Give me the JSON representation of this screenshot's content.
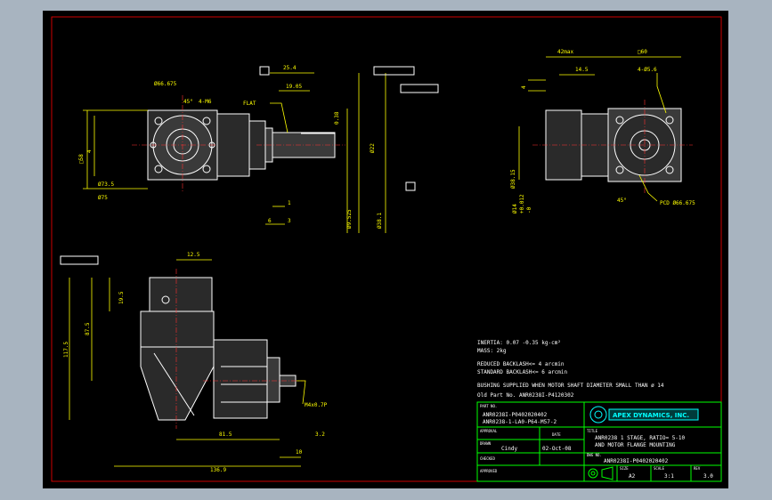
{
  "drawing": {
    "dims_top_left": {
      "d1": "25.4",
      "d2": "19.05",
      "flat": "FLAT",
      "d3": "0.38",
      "d4": "Ø66.675",
      "angle": "45°",
      "d5": "4-M6",
      "d6": "Ø73.5",
      "d7": "Ø75",
      "d8": "□58",
      "d9": "6",
      "d10": "1",
      "d11": "Ø9.525",
      "d12": "Ø38.1",
      "d13": "Ø22",
      "d14": "3",
      "d15": "4"
    },
    "datums": {
      "a_label": "A",
      "b_label": "B",
      "tol1": "0.03",
      "tol1_ref": "A-B",
      "tol2": "0.02",
      "tol2_ref": "A",
      "tol3": "0.05",
      "tol3_ref": "A"
    },
    "dims_top_right": {
      "d1": "42max",
      "d2": "14.5",
      "d3": "□60",
      "d4": "4-Ø5.6",
      "d5": "PCD Ø66.675",
      "d6": "Ø38.15",
      "angle": "45°",
      "d7": "4",
      "d8": "Ø14",
      "d9": "+0.012",
      "d10": "-0"
    },
    "dims_bottom": {
      "d1": "12.5",
      "d2": "19.5",
      "d3": "87.5",
      "d4": "117.5",
      "d5": "81.5",
      "d6": "136.9",
      "d7": "3.2",
      "d8": "10",
      "d9": "M4x0.7P"
    },
    "specs": [
      "INERTIA: 0.07 -0.35 kg-cm²",
      "MASS: 2kg",
      "REDUCED BACKLASH<= 4 arcmin",
      "STANDARD BACKLASH<= 6 arcmin",
      "BUSHING SUPPLIED WHEN MOTOR SHAFT DIAMETER SMALL THAN ø 14",
      "Old Part No. ANR0238I-P4120302"
    ]
  },
  "title_block": {
    "part_no_label": "PART NO.",
    "part_no_1": "ANR0238I-P0402020402",
    "part_no_2": "ANR0238-1-LA0-P64-M57-2",
    "company": "APEX DYNAMICS, INC.",
    "title_label": "TITLE",
    "title_1": "ANR0238 1 STAGE, RATIO= 5-10",
    "title_2": "AND MOTOR FLANGE MOUNTING",
    "approval_label": "APPROVAL",
    "date_label": "DATE",
    "drawn_label": "DRAWN",
    "drawn_by": "Cindy",
    "date": "02-Oct-08",
    "dwg_no_label": "DWG NO.",
    "dwg_no": "ANR0238I-P0402020402",
    "checked_label": "CHECKED",
    "approved_label": "APPROVED",
    "size_label": "SIZE",
    "size": "A2",
    "scale_label": "SCALE",
    "scale": "3:1",
    "rev_label": "REV",
    "rev": "3.0"
  },
  "colors": {
    "background": "#000000",
    "border": "#ff0000",
    "outline": "#ffffff",
    "dimension": "#ffff00",
    "title_block": "#00ff00",
    "logo": "#00ffff"
  }
}
